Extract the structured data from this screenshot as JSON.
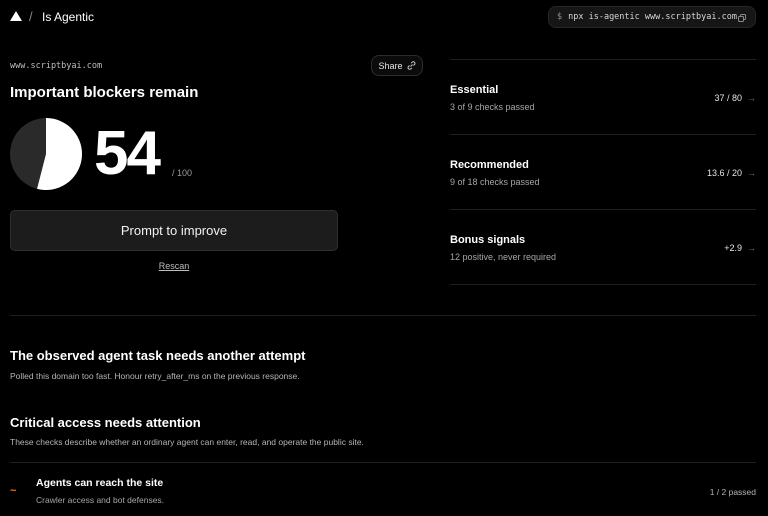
{
  "header": {
    "separator": "/",
    "title": "Is Agentic",
    "command_prompt": "$",
    "command": "npx is-agentic www.scriptbyai.com"
  },
  "summary": {
    "domain": "www.scriptbyai.com",
    "share_label": "Share",
    "headline": "Important blockers remain",
    "score": "54",
    "score_max": "/ 100",
    "score_value": 54,
    "prompt_button": "Prompt to improve",
    "rescan": "Rescan"
  },
  "checks": [
    {
      "title": "Essential",
      "subtitle": "3 of 9 checks passed",
      "score": "37 / 80",
      "arrow": "→"
    },
    {
      "title": "Recommended",
      "subtitle": "9 of 18 checks passed",
      "score": "13.6 / 20",
      "arrow": "→"
    },
    {
      "title": "Bonus signals",
      "subtitle": "12 positive, never required",
      "score": "+2.9",
      "arrow": "→"
    }
  ],
  "sections": {
    "task_title": "The observed agent task needs another attempt",
    "task_text": "Polled this domain too fast. Honour retry_after_ms on the previous response.",
    "critical_title": "Critical access needs attention",
    "critical_text": "These checks describe whether an ordinary agent can enter, read, and operate the public site."
  },
  "access_items": [
    {
      "marker": "~",
      "title": "Agents can reach the site",
      "subtitle": "Crawler access and bot defenses.",
      "count": "1 / 2 passed"
    }
  ],
  "colors": {
    "background": "#000000",
    "warning_marker": "#e07a2b",
    "gauge_fill": "#ffffff",
    "gauge_track": "#2a2a2a"
  }
}
